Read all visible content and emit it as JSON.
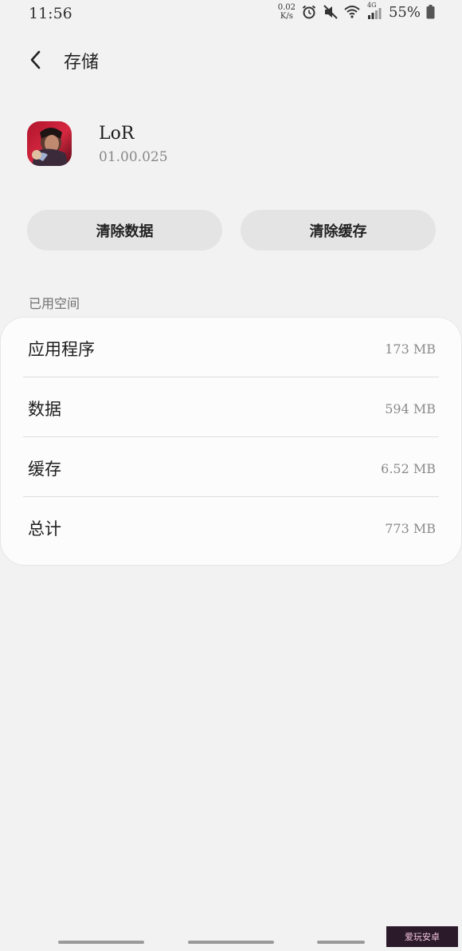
{
  "status_bar": {
    "time": "11:56",
    "speed_value": "0.02",
    "speed_unit": "K/s",
    "network": "4G",
    "battery": "55%"
  },
  "header": {
    "title": "存储"
  },
  "app": {
    "name": "LoR",
    "version": "01.00.025"
  },
  "actions": {
    "clear_data": "清除数据",
    "clear_cache": "清除缓存"
  },
  "storage": {
    "section_label": "已用空间",
    "rows": [
      {
        "label": "应用程序",
        "value": "173 MB"
      },
      {
        "label": "数据",
        "value": "594 MB"
      },
      {
        "label": "缓存",
        "value": "6.52 MB"
      },
      {
        "label": "总计",
        "value": "773 MB"
      }
    ]
  },
  "watermark": "爱玩安卓"
}
